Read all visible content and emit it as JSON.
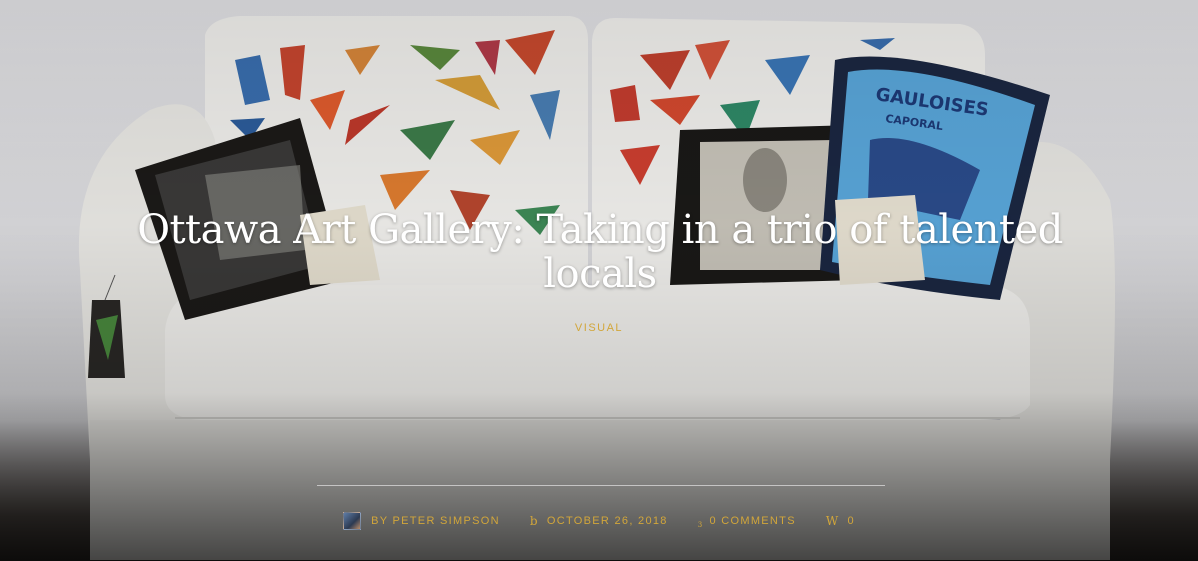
{
  "post": {
    "title": "Ottawa Art Gallery: Taking in a trio of talented locals",
    "category": "VISUAL"
  },
  "meta": {
    "author": "BY PETER SIMPSON",
    "date": "OCTOBER 26, 2018",
    "comments": "0 COMMENTS",
    "likes_icon": "W",
    "likes_count": "0",
    "date_icon": "b",
    "comments_icon": "3"
  },
  "colors": {
    "accent": "#d2a63a",
    "title": "#ffffff"
  }
}
